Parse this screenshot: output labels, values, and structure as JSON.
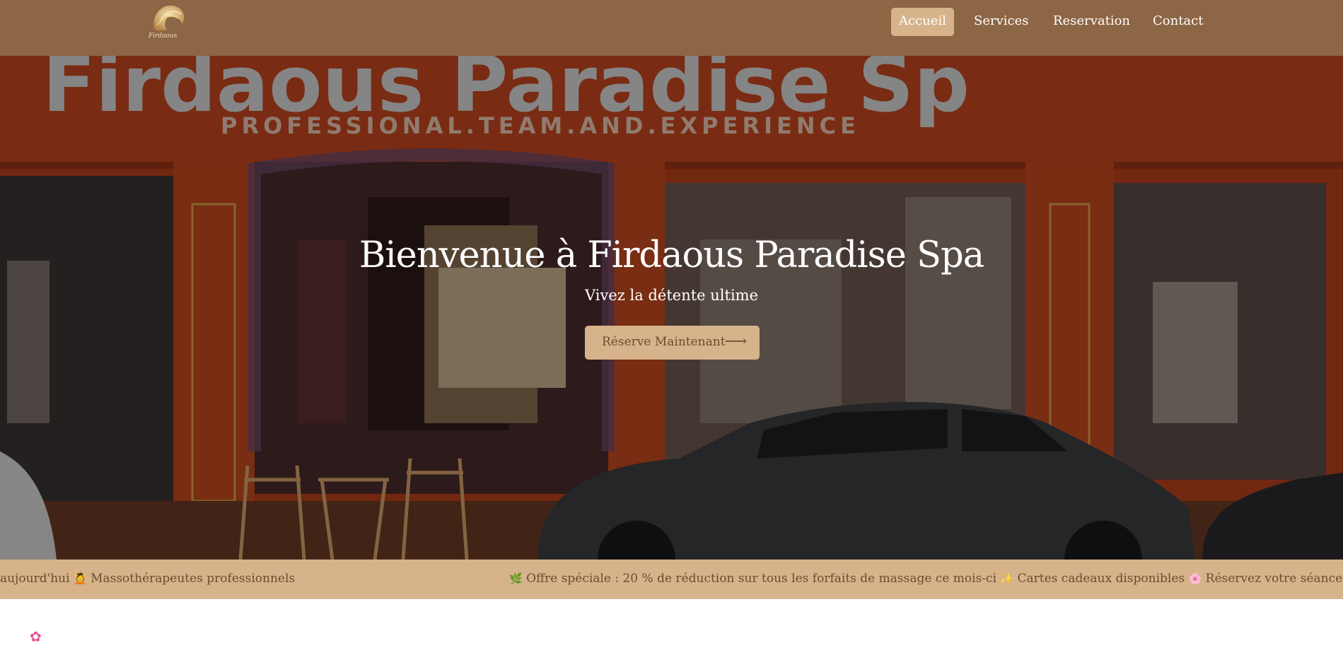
{
  "header": {
    "logo_alt": "Firdaous",
    "nav": [
      {
        "label": "Accueil",
        "active": true
      },
      {
        "label": "Services",
        "active": false
      },
      {
        "label": "Reservation",
        "active": false
      },
      {
        "label": "Contact",
        "active": false
      }
    ]
  },
  "hero": {
    "storefront_sign": "Firdaous Paradise Sp",
    "storefront_tagline": "PROFESSIONAL.TEAM.AND.EXPERIENCE",
    "title": "Bienvenue à Firdaous Paradise Spa",
    "subtitle": "Vivez la détente ultime",
    "cta_label": "Réserve Maintenant",
    "cta_icon": "arrow-right-icon"
  },
  "ticker": {
    "part1": "aujourd'hui",
    "emoji1": "💆",
    "part2": "Massothérapeutes professionnels",
    "emoji2": "🌿",
    "part3": "Offre spéciale : 20 % de réduction sur tous les forfaits de massage ce mois-ci",
    "emoji3": "✨",
    "part4": "Cartes cadeaux disponibles",
    "emoji4": "🌸",
    "part5": "Réservez votre séance de relaxation dès"
  },
  "section_icon": "flower-icon",
  "colors": {
    "header_bg": "#8d6645",
    "accent": "#d6b38a",
    "accent_text": "#6b4d30"
  }
}
